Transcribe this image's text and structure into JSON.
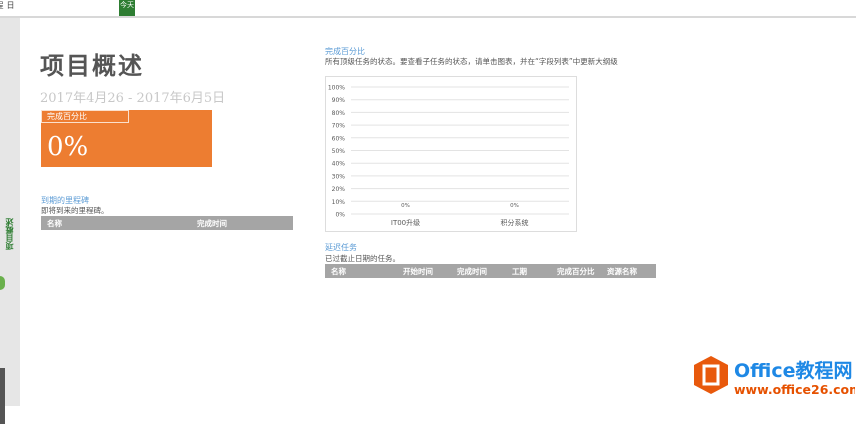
{
  "topbar": {
    "schedule_label": "日程",
    "today_label": "今天"
  },
  "sidebar": {
    "tab_label": "项目概述"
  },
  "header": {
    "title": "项目概述",
    "date_range": "2017年4月26 - 2017年6月5日"
  },
  "percent_card": {
    "label": "完成百分比",
    "value": "0%"
  },
  "milestones": {
    "title": "到期的里程碑",
    "subtitle": "即将到来的里程碑。",
    "columns": [
      "名称",
      "完成时间"
    ]
  },
  "completion": {
    "title": "完成百分比",
    "description": "所有顶级任务的状态。要查看子任务的状态，请单击图表，并在“字段列表”中更新大纲级"
  },
  "chart_data": {
    "type": "bar",
    "categories": [
      "IT00升级",
      "积分系统"
    ],
    "values": [
      0,
      0
    ],
    "data_labels": [
      "0%",
      "0%"
    ],
    "ylim": [
      0,
      100
    ],
    "yticks": [
      "0%",
      "10%",
      "20%",
      "30%",
      "40%",
      "50%",
      "60%",
      "70%",
      "80%",
      "90%",
      "100%"
    ],
    "grid": true
  },
  "late_tasks": {
    "title": "延迟任务",
    "subtitle": "已过截止日期的任务。",
    "columns": [
      "名称",
      "开始时间",
      "完成时间",
      "工期",
      "完成百分比",
      "资源名称"
    ]
  },
  "logo": {
    "brand": "Office教程网",
    "url": "www.office26.com",
    "brand_color": "#1e88e5",
    "url_color": "#e65100"
  }
}
